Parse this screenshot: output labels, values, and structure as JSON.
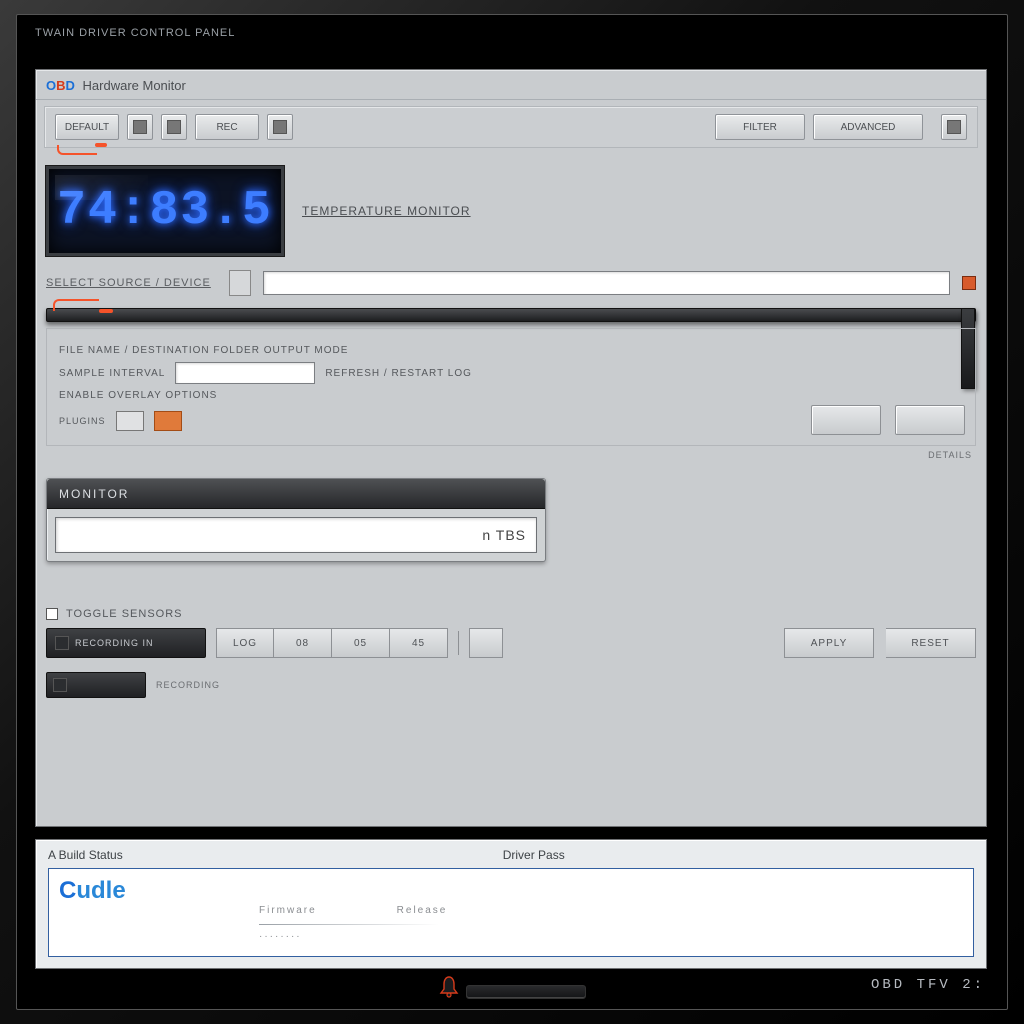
{
  "window": {
    "title": "TWAIN DRIVER CONTROL PANEL"
  },
  "panel": {
    "brand_prefix": "O",
    "brand_mid": "B",
    "brand_suffix": "D",
    "title_rest": "Hardware Monitor"
  },
  "toolbar": {
    "buttons": [
      "DEFAULT",
      "",
      "",
      "REC",
      ""
    ],
    "right": [
      "FILTER",
      "ADVANCED"
    ]
  },
  "lcd": {
    "readout": "74:83.5",
    "label": "TEMPERATURE  MONITOR"
  },
  "source": {
    "label": "SELECT SOURCE / DEVICE",
    "path_value": ""
  },
  "options": {
    "row1": "FILE NAME / DESTINATION FOLDER OUTPUT MODE",
    "row2_left": "SAMPLE INTERVAL",
    "row2_right": "REFRESH / RESTART LOG",
    "row3": "ENABLE OVERLAY OPTIONS",
    "chip_label": "PLUGINS",
    "side_text": "DETAILS"
  },
  "module": {
    "title": "MONITOR",
    "input_value": "n TBS"
  },
  "segment": {
    "check_label": "TOGGLE SENSORS",
    "dark_label": "RECORDING IN",
    "items": [
      "LOG",
      "08",
      "05",
      "45"
    ],
    "small": "",
    "action1": "APPLY",
    "action2": "RESET"
  },
  "single": {
    "label": "RECORDING"
  },
  "info": {
    "left_heading": "A  Build Status",
    "right_heading": "Driver Pass",
    "brand": "Cudle",
    "line1": "Firmware",
    "line2": "Release"
  },
  "status": {
    "corner": "OBD TFV 2:"
  }
}
